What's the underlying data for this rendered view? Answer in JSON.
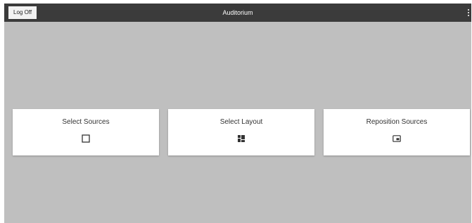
{
  "header": {
    "title": "Auditorium",
    "logoff_label": "Log Off",
    "menu_icon": "more-vertical-icon"
  },
  "cards": [
    {
      "label": "Select Sources",
      "icon": "square-outline-icon"
    },
    {
      "label": "Select Layout",
      "icon": "layout-grid-icon"
    },
    {
      "label": "Reposition Sources",
      "icon": "picture-in-picture-icon"
    }
  ],
  "colors": {
    "topbar": "#3b3b3b",
    "background": "#bfbfbf",
    "card": "#ffffff",
    "text": "#333333"
  }
}
